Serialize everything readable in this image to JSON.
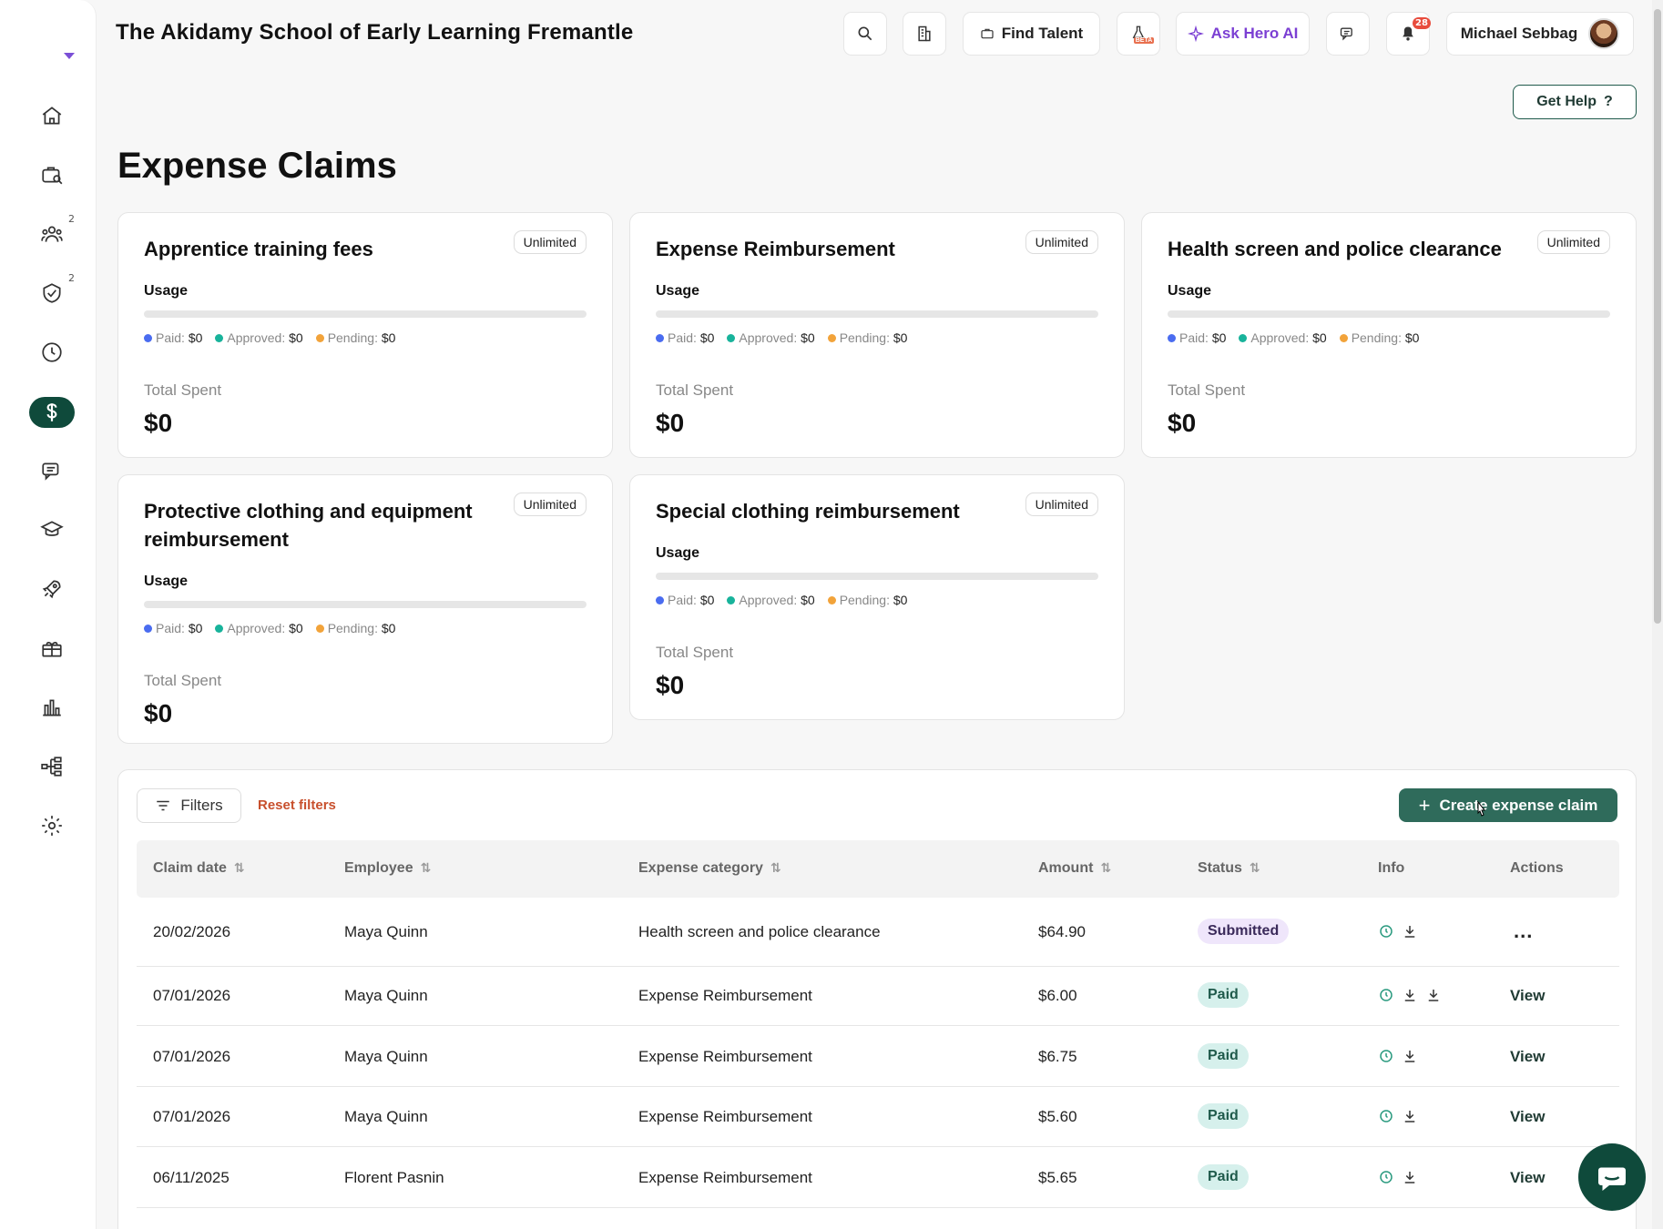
{
  "header": {
    "org_name": "The Akidamy School of Early Learning Fremantle",
    "find_talent": "Find Talent",
    "beta_label": "BETA",
    "ask_ai": "Ask Hero AI",
    "notifications_count": "28",
    "user_name": "Michael Sebbag",
    "help": "Get Help"
  },
  "sidebar": {
    "items": [
      {
        "icon": "home-icon"
      },
      {
        "icon": "briefcase-search-icon"
      },
      {
        "icon": "people-icon",
        "badge": "2"
      },
      {
        "icon": "check-shield-icon",
        "badge": "2"
      },
      {
        "icon": "clock-icon"
      },
      {
        "icon": "dollar-icon",
        "active": true
      },
      {
        "icon": "chat-icon"
      },
      {
        "icon": "graduation-cap-icon"
      },
      {
        "icon": "rocket-icon"
      },
      {
        "icon": "gift-icon"
      },
      {
        "icon": "bar-chart-icon"
      },
      {
        "icon": "org-chart-icon"
      },
      {
        "icon": "gear-icon"
      }
    ]
  },
  "page": {
    "title": "Expense Claims"
  },
  "cards": [
    {
      "title": "Apprentice training fees",
      "badge": "Unlimited",
      "usage_label": "Usage",
      "paid_label": "Paid:",
      "paid": "$0",
      "approved_label": "Approved:",
      "approved": "$0",
      "pending_label": "Pending:",
      "pending": "$0",
      "total_label": "Total Spent",
      "total": "$0"
    },
    {
      "title": "Expense Reimbursement",
      "badge": "Unlimited",
      "usage_label": "Usage",
      "paid_label": "Paid:",
      "paid": "$0",
      "approved_label": "Approved:",
      "approved": "$0",
      "pending_label": "Pending:",
      "pending": "$0",
      "total_label": "Total Spent",
      "total": "$0"
    },
    {
      "title": "Health screen and police clearance",
      "badge": "Unlimited",
      "usage_label": "Usage",
      "paid_label": "Paid:",
      "paid": "$0",
      "approved_label": "Approved:",
      "approved": "$0",
      "pending_label": "Pending:",
      "pending": "$0",
      "total_label": "Total Spent",
      "total": "$0"
    },
    {
      "title": "Protective clothing and equipment reimbursement",
      "badge": "Unlimited",
      "usage_label": "Usage",
      "paid_label": "Paid:",
      "paid": "$0",
      "approved_label": "Approved:",
      "approved": "$0",
      "pending_label": "Pending:",
      "pending": "$0",
      "total_label": "Total Spent",
      "total": "$0"
    },
    {
      "title": "Special clothing reimbursement",
      "badge": "Unlimited",
      "usage_label": "Usage",
      "paid_label": "Paid:",
      "paid": "$0",
      "approved_label": "Approved:",
      "approved": "$0",
      "pending_label": "Pending:",
      "pending": "$0",
      "total_label": "Total Spent",
      "total": "$0"
    }
  ],
  "legend_colors": {
    "paid": "#4a6cf0",
    "approved": "#18b39b",
    "pending": "#f2a33a"
  },
  "table": {
    "filters": "Filters",
    "reset": "Reset filters",
    "create": "Create expense claim",
    "columns": [
      "Claim date",
      "Employee",
      "Expense category",
      "Amount",
      "Status",
      "Info",
      "Actions"
    ],
    "rows": [
      {
        "date": "20/02/2026",
        "employee": "Maya Quinn",
        "category": "Health screen and police clearance",
        "amount": "$64.90",
        "status": "Submitted",
        "action": "..."
      },
      {
        "date": "07/01/2026",
        "employee": "Maya Quinn",
        "category": "Expense Reimbursement",
        "amount": "$6.00",
        "status": "Paid",
        "action": "View"
      },
      {
        "date": "07/01/2026",
        "employee": "Maya Quinn",
        "category": "Expense Reimbursement",
        "amount": "$6.75",
        "status": "Paid",
        "action": "View"
      },
      {
        "date": "07/01/2026",
        "employee": "Maya Quinn",
        "category": "Expense Reimbursement",
        "amount": "$5.60",
        "status": "Paid",
        "action": "View"
      },
      {
        "date": "06/11/2025",
        "employee": "Florent Pasnin",
        "category": "Expense Reimbursement",
        "amount": "$5.65",
        "status": "Paid",
        "action": "View"
      }
    ]
  },
  "colors": {
    "brand_dark": "#0f4a3b",
    "create_button": "#2f6b5b",
    "reset_link": "#c8502d",
    "ai_purple": "#7b3fd3"
  }
}
